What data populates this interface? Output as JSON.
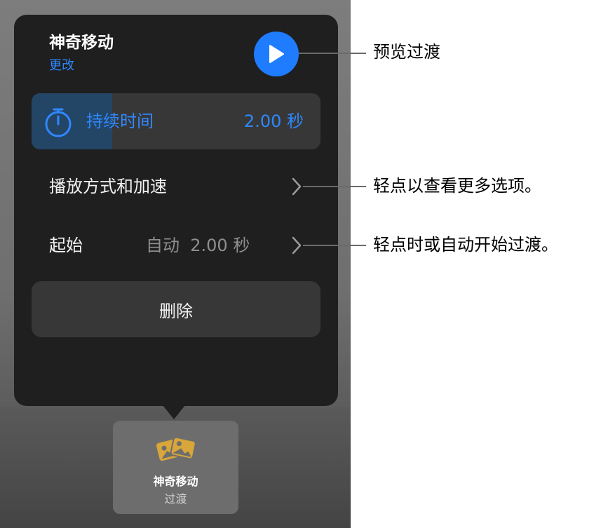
{
  "popover": {
    "title": "神奇移动",
    "change_label": "更改",
    "play_icon": "play-icon",
    "duration": {
      "label": "持续时间",
      "value": "2.00 秒",
      "icon": "stopwatch-icon",
      "fill_fraction": 0.28
    },
    "playback_row": {
      "label": "播放方式和加速",
      "icon": "chevron-right-icon"
    },
    "start_row": {
      "label": "起始",
      "value": "自动  2.00 秒",
      "icon": "chevron-right-icon"
    },
    "delete_label": "删除"
  },
  "tile": {
    "icon": "photos-transition-icon",
    "title": "神奇移动",
    "subtitle": "过渡"
  },
  "callouts": {
    "preview": "预览过渡",
    "more_options": "轻点以查看更多选项。",
    "start_transition": "轻点时或自动开始过渡。"
  },
  "colors": {
    "accent": "#1f7cff",
    "popover_bg": "#1f1f1f",
    "row_bg": "#373737",
    "tile_icon": "#d8a63a"
  }
}
